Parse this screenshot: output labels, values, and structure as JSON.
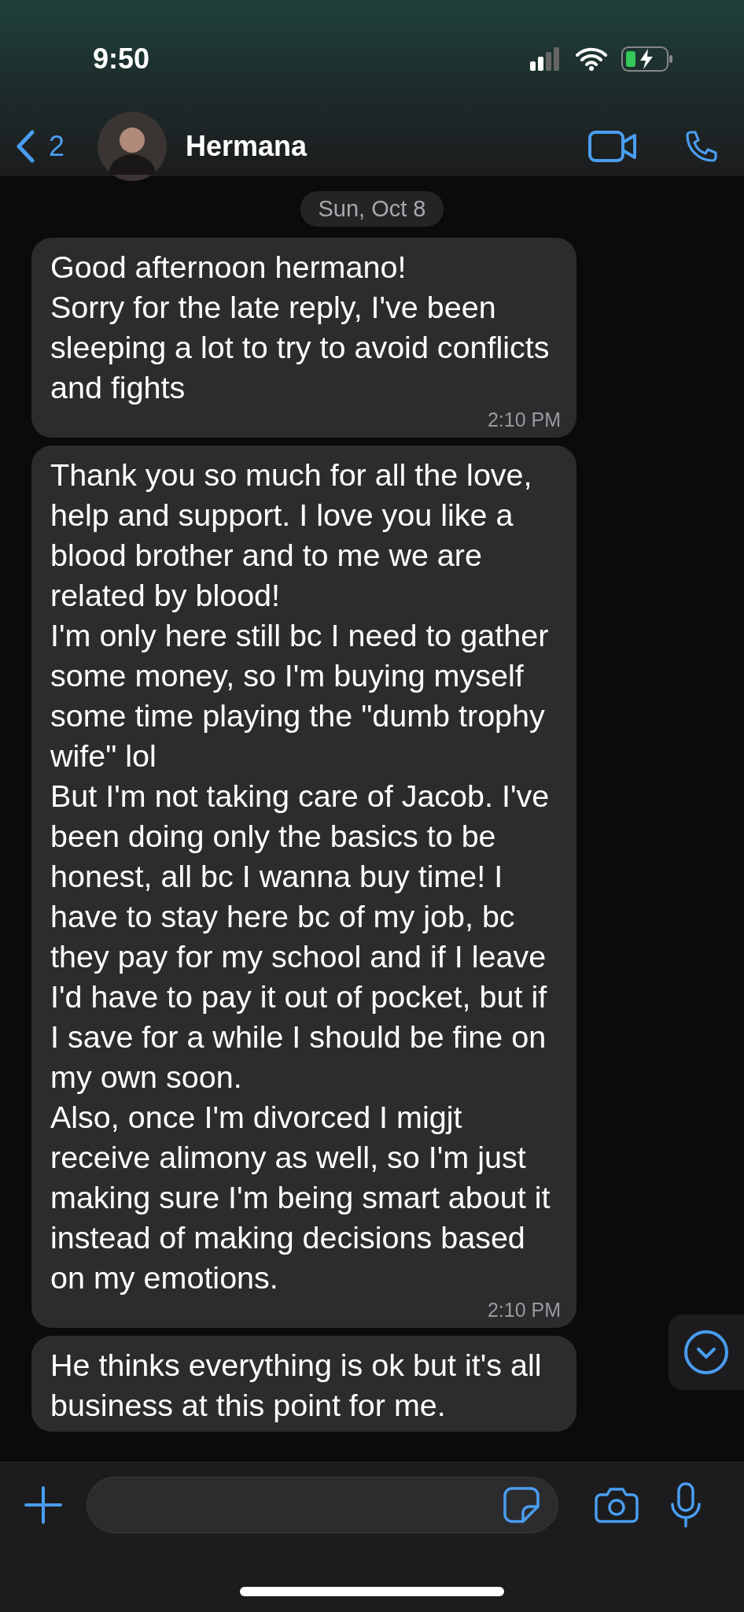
{
  "status_bar": {
    "time": "9:50"
  },
  "header": {
    "back_count": "2",
    "contact_name": "Hermana"
  },
  "date_divider": "Sun, Oct 8",
  "messages": [
    {
      "text": "Good afternoon hermano!\nSorry for the late reply, I've been sleeping a lot to try to avoid conflicts and fights",
      "time": "2:10 PM"
    },
    {
      "text": "Thank you so much for all the love, help and support. I love you like a blood brother and to me we are related by blood!\nI'm only here still bc I need to gather some money, so I'm buying myself some time playing the \"dumb trophy wife\" lol\nBut I'm not taking care of Jacob. I've been doing only the basics to be honest, all bc I wanna buy time! I have to stay here bc of my job, bc they pay for my school and if I leave I'd have to pay it out of pocket, but if I save for a while I should be fine on my own soon.\nAlso, once I'm divorced I migjt receive alimony as well, so I'm just making sure I'm being smart about it instead of making decisions based on my emotions.",
      "time": "2:10 PM"
    },
    {
      "text": "He thinks everything is ok but it's all business at this point for me."
    }
  ]
}
